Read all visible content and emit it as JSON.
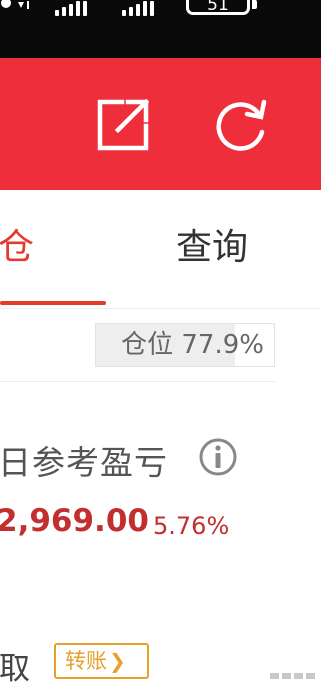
{
  "status_bar": {
    "battery": "51",
    "icon": "wifi-icon",
    "signal_icons": [
      "signal-icon",
      "signal-icon"
    ]
  },
  "header": {
    "background": "#ee2e3a",
    "icons": [
      "share-icon",
      "refresh-icon"
    ]
  },
  "tabs": {
    "active_label": "仓",
    "query_label": "查询",
    "active_color": "#e23c2f"
  },
  "position": {
    "label": "仓位 77.9%",
    "ratio": 0.779
  },
  "profit": {
    "label": "日参考盈亏",
    "value": "2,969.00",
    "percent": "5.76%",
    "color": "#c32f2f",
    "icon": "info-icon"
  },
  "withdraw": {
    "label": "取",
    "transfer_button": "转账",
    "transfer_icon": "chevron-right-icon",
    "accent": "#e7a02a"
  }
}
